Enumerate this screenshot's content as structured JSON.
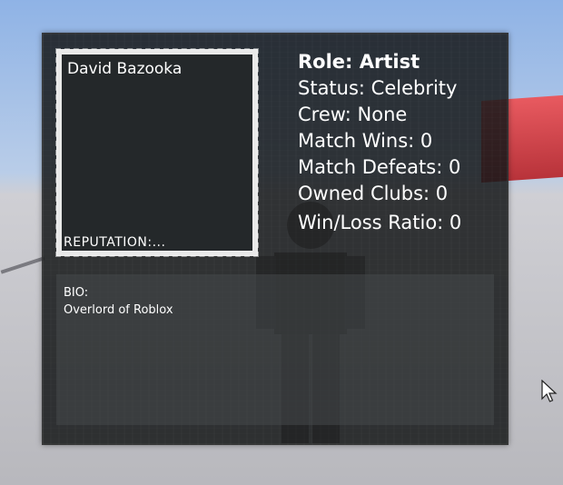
{
  "player_card": {
    "display_name": "David Bazooka",
    "reputation_label": "REPUTATION:...",
    "stats": [
      {
        "label": "Role: Artist",
        "bold": true
      },
      {
        "label": "Status: Celebrity"
      },
      {
        "label": "Crew: None"
      },
      {
        "label": "Match Wins: 0"
      },
      {
        "label": "Match Defeats: 0"
      },
      {
        "label": "Owned Clubs: 0"
      },
      {
        "label": "Win/Loss Ratio: 0"
      }
    ],
    "bio_label": "BIO:",
    "bio_text": "Overlord of Roblox"
  },
  "colors": {
    "panel": "#16181a",
    "text": "#ffffff",
    "portrait_border": "#e9e9e9",
    "sky": "#8fb3e6",
    "red_block": "#e85a60"
  },
  "icons": [
    "mouse-cursor-icon"
  ]
}
